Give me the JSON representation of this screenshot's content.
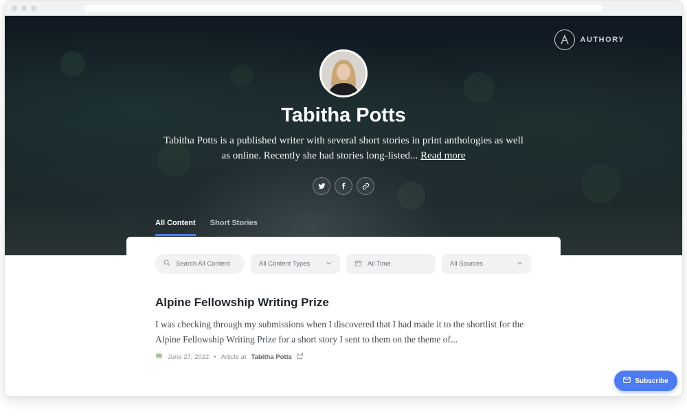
{
  "brand": {
    "name": "AUTHORY"
  },
  "profile": {
    "name": "Tabitha Potts",
    "bio": "Tabitha Potts is a published writer with several short stories in print anthologies as well as online. Recently she had stories long-listed...",
    "read_more": "Read more",
    "socials": [
      "twitter-icon",
      "facebook-icon",
      "link-icon"
    ]
  },
  "tabs": [
    {
      "label": "All Content",
      "active": true
    },
    {
      "label": "Short Stories",
      "active": false
    }
  ],
  "filters": {
    "search_placeholder": "Search All Content",
    "content_types": "All Content Types",
    "time": "All Time",
    "sources": "All Sources"
  },
  "articles": [
    {
      "title": "Alpine Fellowship Writing Prize",
      "excerpt": "I was checking through my submissions when I discovered that I had made it to the shortlist for the Alpine Fellowship Writing Prize for a short story I sent to them on the theme of...",
      "date": "June 27, 2022",
      "type": "Article at",
      "source": "Tabitha Potts"
    }
  ],
  "subscribe": {
    "label": "Subscribe"
  },
  "colors": {
    "accent": "#4c7bf2",
    "hero_dark": "#0f1821"
  }
}
